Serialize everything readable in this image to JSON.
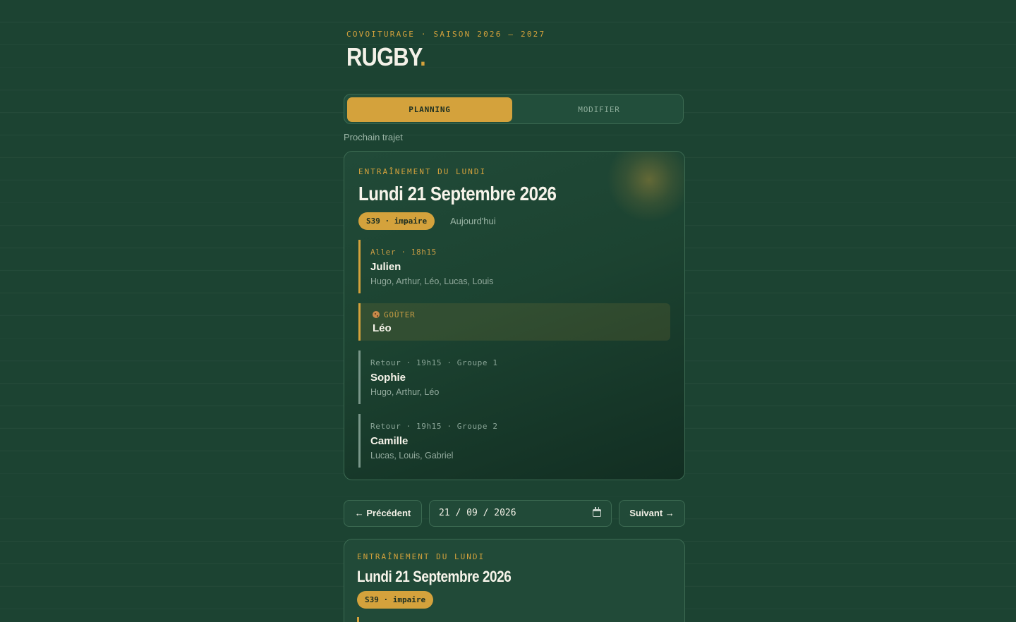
{
  "header": {
    "eyebrow": "COVOITURAGE · SAISON 2026 – 2027",
    "title": "RUGBY",
    "title_dot": "."
  },
  "tabs": [
    {
      "label": "PLANNING",
      "active": true
    },
    {
      "label": "MODIFIER",
      "active": false
    }
  ],
  "next_trip_label": "Prochain trajet",
  "next_card": {
    "eyebrow": "ENTRAÎNEMENT DU LUNDI",
    "title": "Lundi 21 Septembre 2026",
    "badge": "S39 · impaire",
    "today": "Aujourd'hui",
    "trips": [
      {
        "meta": "Aller · 18h15",
        "driver": "Julien",
        "kids": "Hugo, Arthur, Léo, Lucas, Louis"
      },
      {
        "meta": "Retour · 19h15 · Groupe 1",
        "driver": "Sophie",
        "kids": "Hugo, Arthur, Léo"
      },
      {
        "meta": "Retour · 19h15 · Groupe 2",
        "driver": "Camille",
        "kids": "Lucas, Louis, Gabriel"
      }
    ],
    "snack": {
      "icon": "cookie-icon",
      "meta": "GOÛTER",
      "driver": "Léo"
    }
  },
  "nav": {
    "prev_label": "← Précédent",
    "date_value": "21 / 09 / 2026",
    "next_label": "Suivant →"
  },
  "week_card": {
    "eyebrow": "ENTRAÎNEMENT DU LUNDI",
    "title": "Lundi 21 Septembre 2026",
    "badge": "S39 · impaire"
  },
  "colors": {
    "background": "#1c4332",
    "accent": "#d4a23c",
    "card_border": "#3c6a52",
    "muted_text": "#9bb5a6"
  }
}
